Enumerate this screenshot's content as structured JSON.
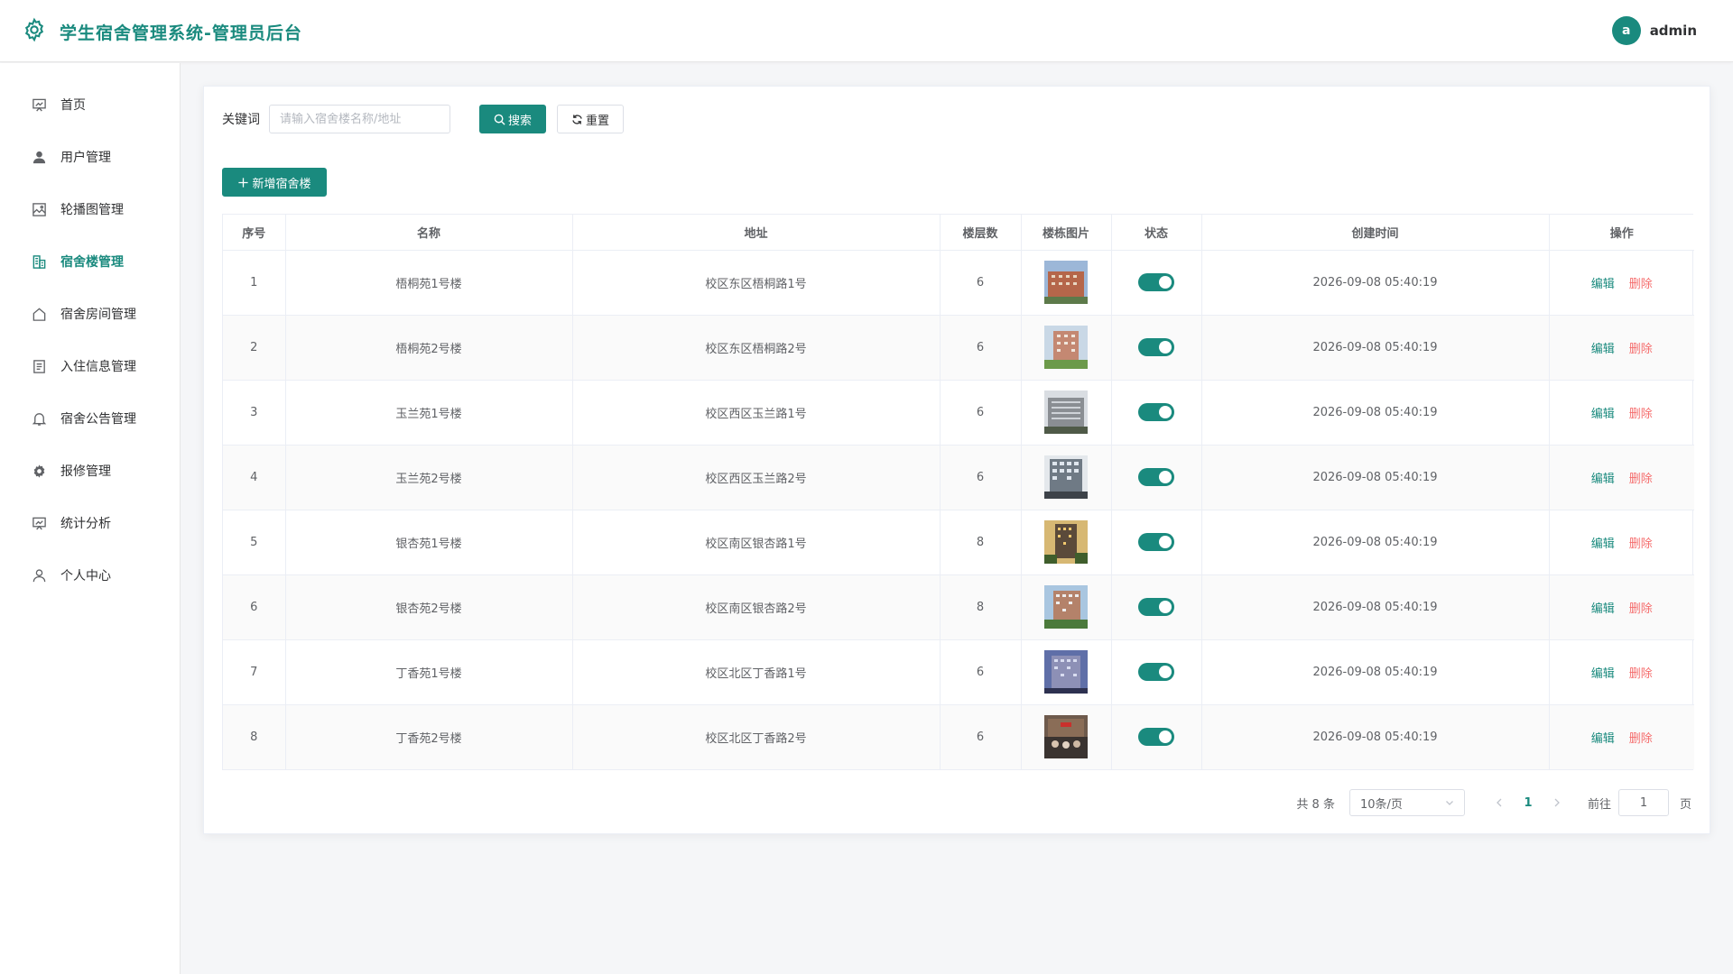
{
  "app": {
    "title": "学生宿舍管理系统-管理员后台",
    "accent": "#1a8a7e",
    "user": {
      "avatar_letter": "a",
      "name": "admin"
    }
  },
  "sidebar": {
    "items": [
      {
        "label": "首页",
        "icon": "chart-board-icon",
        "active": false
      },
      {
        "label": "用户管理",
        "icon": "user-icon",
        "active": false
      },
      {
        "label": "轮播图管理",
        "icon": "picture-icon",
        "active": false
      },
      {
        "label": "宿舍楼管理",
        "icon": "building-icon",
        "active": true
      },
      {
        "label": "宿舍房间管理",
        "icon": "house-icon",
        "active": false
      },
      {
        "label": "入住信息管理",
        "icon": "document-icon",
        "active": false
      },
      {
        "label": "宿舍公告管理",
        "icon": "bell-icon",
        "active": false
      },
      {
        "label": "报修管理",
        "icon": "gear-icon",
        "active": false
      },
      {
        "label": "统计分析",
        "icon": "chart-board-icon",
        "active": false
      },
      {
        "label": "个人中心",
        "icon": "user-outline-icon",
        "active": false
      }
    ]
  },
  "search": {
    "label": "关键词",
    "placeholder": "请输入宿舍楼名称/地址",
    "value": "",
    "search_button": "搜索",
    "reset_button": "重置"
  },
  "actions": {
    "add_button": "新增宿舍楼"
  },
  "table": {
    "columns": [
      "序号",
      "名称",
      "地址",
      "楼层数",
      "楼栋图片",
      "状态",
      "创建时间",
      "操作"
    ],
    "edit_label": "编辑",
    "delete_label": "删除",
    "rows": [
      {
        "index": "1",
        "name": "梧桐苑1号楼",
        "address": "校区东区梧桐路1号",
        "floors": "6",
        "photo": "building-photo",
        "enabled": true,
        "created": "2026-09-08 05:40:19"
      },
      {
        "index": "2",
        "name": "梧桐苑2号楼",
        "address": "校区东区梧桐路2号",
        "floors": "6",
        "photo": "building-photo",
        "enabled": true,
        "created": "2026-09-08 05:40:19"
      },
      {
        "index": "3",
        "name": "玉兰苑1号楼",
        "address": "校区西区玉兰路1号",
        "floors": "6",
        "photo": "building-photo",
        "enabled": true,
        "created": "2026-09-08 05:40:19"
      },
      {
        "index": "4",
        "name": "玉兰苑2号楼",
        "address": "校区西区玉兰路2号",
        "floors": "6",
        "photo": "building-photo",
        "enabled": true,
        "created": "2026-09-08 05:40:19"
      },
      {
        "index": "5",
        "name": "银杏苑1号楼",
        "address": "校区南区银杏路1号",
        "floors": "8",
        "photo": "building-photo",
        "enabled": true,
        "created": "2026-09-08 05:40:19"
      },
      {
        "index": "6",
        "name": "银杏苑2号楼",
        "address": "校区南区银杏路2号",
        "floors": "8",
        "photo": "building-photo",
        "enabled": true,
        "created": "2026-09-08 05:40:19"
      },
      {
        "index": "7",
        "name": "丁香苑1号楼",
        "address": "校区北区丁香路1号",
        "floors": "6",
        "photo": "building-photo",
        "enabled": true,
        "created": "2026-09-08 05:40:19"
      },
      {
        "index": "8",
        "name": "丁香苑2号楼",
        "address": "校区北区丁香路2号",
        "floors": "6",
        "photo": "building-photo",
        "enabled": true,
        "created": "2026-09-08 05:40:19"
      }
    ]
  },
  "pagination": {
    "total_text": "共 8 条",
    "page_size": "10条/页",
    "current_page": "1",
    "goto_label": "前往",
    "goto_value": "1",
    "goto_suffix": "页"
  }
}
